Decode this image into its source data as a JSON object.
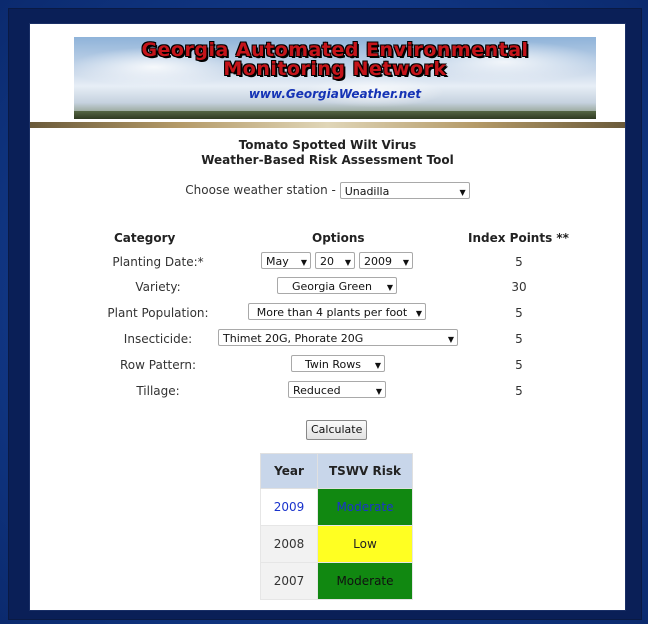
{
  "banner": {
    "title_line1": "Georgia Automated Environmental",
    "title_line2": "Monitoring Network",
    "url": "www.GeorgiaWeather.net"
  },
  "tool": {
    "title_line1": "Tomato Spotted Wilt Virus",
    "title_line2": "Weather-Based Risk Assessment Tool"
  },
  "station": {
    "label": "Choose weather station -",
    "selected": "Unadilla"
  },
  "headers": {
    "category": "Category",
    "options": "Options",
    "index_points": "Index Points **"
  },
  "rows": [
    {
      "label": "Planting Date:*",
      "month": "May",
      "day": "20",
      "year": "2009",
      "points": "5"
    },
    {
      "label": "Variety:",
      "value": "Georgia Green",
      "points": "30"
    },
    {
      "label": "Plant Population:",
      "value": "More than 4 plants per foot",
      "points": "5"
    },
    {
      "label": "Insecticide:",
      "value": "Thimet 20G, Phorate 20G",
      "points": "5"
    },
    {
      "label": "Row Pattern:",
      "value": "Twin Rows",
      "points": "5"
    },
    {
      "label": "Tillage:",
      "value": "Reduced",
      "points": "5"
    }
  ],
  "calculate_label": "Calculate",
  "results": {
    "headers": [
      "Year",
      "TSWV Risk"
    ],
    "rows": [
      {
        "year": "2009",
        "risk": "Moderate",
        "color": "#118811",
        "text_color": "#1a33cc",
        "year_color": "#1a33cc"
      },
      {
        "year": "2008",
        "risk": "Low",
        "color": "#ffff22",
        "text_color": "#222222",
        "year_color": "#333333"
      },
      {
        "year": "2007",
        "risk": "Moderate",
        "color": "#118811",
        "text_color": "#111111",
        "year_color": "#333333"
      }
    ]
  }
}
